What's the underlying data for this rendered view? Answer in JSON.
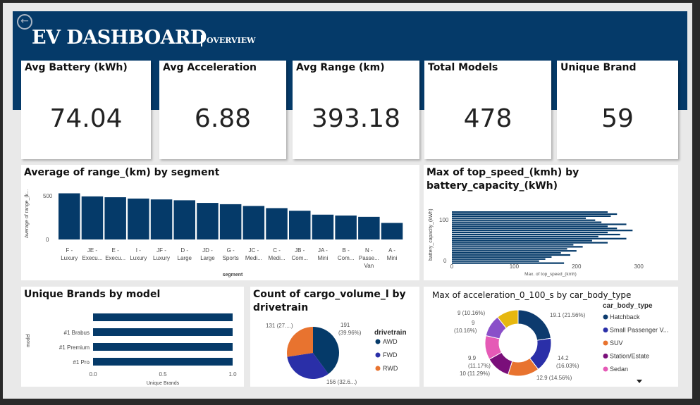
{
  "header": {
    "title": "EV DASHBOARD",
    "subtitle": "OVERVIEW",
    "back_icon": "back-arrow-icon"
  },
  "kpis": [
    {
      "label": "Avg Battery (kWh)",
      "value": "74.04"
    },
    {
      "label": "Avg Acceleration",
      "value": "6.88"
    },
    {
      "label": "Avg Range (km)",
      "value": "393.18"
    },
    {
      "label": "Total Models",
      "value": "478"
    },
    {
      "label": "Unique Brand",
      "value": "59"
    }
  ],
  "colors": {
    "navy": "#053a69",
    "hatchback": "#0d3b6e",
    "small_passenger": "#2a2fa8",
    "suv": "#e8732f",
    "station": "#7a0f7a",
    "sedan": "#e55ab6",
    "yellow": "#e6b70f",
    "purple": "#8a4fc9"
  },
  "chart_data": [
    {
      "type": "bar",
      "title": "Average of range_(km) by segment",
      "xlabel": "segment",
      "ylabel": "Average of range_(k...",
      "ylim": [
        0,
        550
      ],
      "yticks": [
        "0",
        "500"
      ],
      "categories": [
        "F - Luxury",
        "JE - Execu...",
        "E - Execu...",
        "I - Luxury",
        "JF - Luxury",
        "D - Large",
        "JD - Large",
        "G - Sports",
        "JC - Medi...",
        "C - Medi...",
        "JB - Com...",
        "JA - Mini",
        "B - Com...",
        "N - Passe... Van",
        "A - Mini"
      ],
      "tick_top": [
        "F -",
        "JE -",
        "E -",
        "I -",
        "JF -",
        "D -",
        "JD -",
        "G -",
        "JC -",
        "C -",
        "JB -",
        "JA -",
        "B -",
        "N -",
        "A -"
      ],
      "tick_bottom": [
        "Luxury",
        "Execu...",
        "Execu...",
        "Luxury",
        "Luxury",
        "Large",
        "Large",
        "Sports",
        "Medi...",
        "Medi...",
        "Com...",
        "Mini",
        "Com...",
        "Passe...",
        "Mini"
      ],
      "tick_extra": [
        "",
        "",
        "",
        "",
        "",
        "",
        "",
        "",
        "",
        "",
        "",
        "",
        "",
        "Van",
        ""
      ],
      "values": [
        530,
        495,
        485,
        470,
        460,
        450,
        420,
        405,
        385,
        360,
        330,
        285,
        275,
        260,
        190
      ]
    },
    {
      "type": "bar",
      "orientation": "horizontal",
      "title": "Max of top_speed_(kmh) by battery_capacity_(kWh)",
      "xlabel": "Max. of top_speed_(kmh)",
      "ylabel": "battery_capacity_(kWh)",
      "xlim": [
        0,
        350
      ],
      "xticks": [
        "0",
        "100",
        "200",
        "300"
      ],
      "yticks": [
        "0",
        "100"
      ],
      "values": [
        250,
        265,
        255,
        215,
        230,
        240,
        280,
        250,
        265,
        290,
        250,
        270,
        235,
        280,
        225,
        250,
        195,
        210,
        185,
        200,
        175,
        190,
        160,
        150,
        140,
        180
      ]
    },
    {
      "type": "bar",
      "orientation": "horizontal",
      "title": "Unique Brands by model",
      "xlabel": "Unique Brands",
      "ylabel": "model",
      "xlim": [
        0,
        1
      ],
      "xticks": [
        "0.0",
        "0.5",
        "1.0"
      ],
      "categories": [
        "",
        "#1 Brabus",
        "#1 Premium",
        "#1 Pro"
      ],
      "values": [
        1,
        1,
        1,
        1
      ]
    },
    {
      "type": "pie",
      "title": "Count of cargo_volume_l by drivetrain",
      "legend_title": "drivetrain",
      "categories": [
        "AWD",
        "FWD",
        "RWD"
      ],
      "values": [
        191,
        156,
        131
      ],
      "labels": [
        "191",
        "(39.96%)",
        "156 (32.6...)",
        "131 (27....)"
      ]
    },
    {
      "type": "pie",
      "style": "donut",
      "title": "Max of acceleration_0_100_s by car_body_type",
      "legend_title": "car_body_type",
      "legend": [
        "Hatchback",
        "Small Passenger V...",
        "SUV",
        "Station/Estate",
        "Sedan"
      ],
      "values": [
        19.1,
        14.2,
        12.9,
        10,
        9.9,
        9,
        9
      ],
      "labels": [
        "19.1 (21.56%)",
        "14.2",
        "(16.03%)",
        "12.9 (14.56%)",
        "10 (11.29%)",
        "9.9",
        "(11.17%)",
        "9",
        "(10.16%)",
        "9 (10.16%)"
      ]
    }
  ]
}
